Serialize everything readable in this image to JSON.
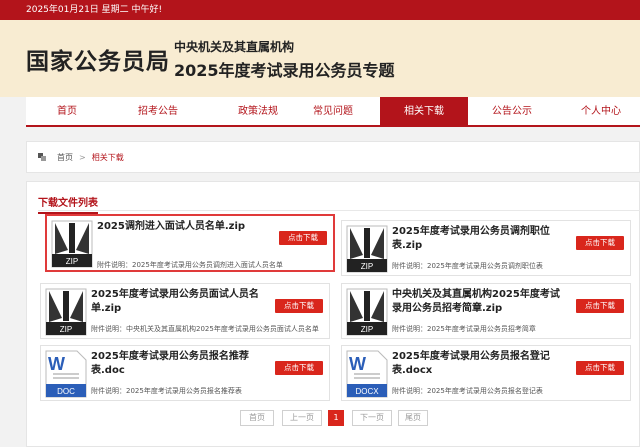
{
  "topbar": {
    "text": "2025年01月21日  星期二  中午好!"
  },
  "header": {
    "logo": "国家公务员局",
    "subtitle1": "中央机关及其直属机构",
    "subtitle2": "2025年度考试录用公务员专题"
  },
  "nav": {
    "items": [
      {
        "label": "首页"
      },
      {
        "label": "招考公告"
      },
      {
        "label": "政策法规"
      },
      {
        "label": "常见问题"
      },
      {
        "label": "相关下载",
        "active": true
      },
      {
        "label": "公告公示"
      },
      {
        "label": "个人中心"
      }
    ]
  },
  "breadcrumb": {
    "home": "首页",
    "separator": ">",
    "current": "相关下载"
  },
  "panel": {
    "title": "下载文件列表"
  },
  "files": [
    {
      "title": "2025调剂进入面试人员名单.zip",
      "desc": "附件说明：2025年度考试录用公务员调剂进入面试人员名单",
      "type": "ZIP",
      "icon": "zip-icon",
      "selected": true
    },
    {
      "title": "2025年度考试录用公务员调剂职位表.zip",
      "desc": "附件说明：2025年度考试录用公务员调剂职位表",
      "type": "ZIP",
      "icon": "zip-icon"
    },
    {
      "title": "2025年度考试录用公务员面试人员名单.zip",
      "desc": "附件说明：中央机关及其直属机构2025年度考试录用公务员面试人员名单",
      "type": "ZIP",
      "icon": "zip-icon"
    },
    {
      "title": "中央机关及其直属机构2025年度考试录用公务员招考简章.zip",
      "desc": "附件说明：2025年度考试录用公务员招考简章",
      "type": "ZIP",
      "icon": "zip-icon"
    },
    {
      "title": "2025年度考试录用公务员报名推荐表.doc",
      "desc": "附件说明：2025年度考试录用公务员报名推荐表",
      "type": "DOC",
      "icon": "doc-icon"
    },
    {
      "title": "2025年度考试录用公务员报名登记表.docx",
      "desc": "附件说明：2025年度考试录用公务员报名登记表",
      "type": "DOCX",
      "icon": "docx-icon"
    }
  ],
  "download_label": "点击下载",
  "pagination": {
    "first": "首页",
    "prev": "上一页",
    "current": "1",
    "next": "下一页",
    "last": "尾页"
  },
  "colors": {
    "brand_red": "#b3141b",
    "button_red": "#d9261c",
    "header_bg": "#f8ecd2"
  }
}
